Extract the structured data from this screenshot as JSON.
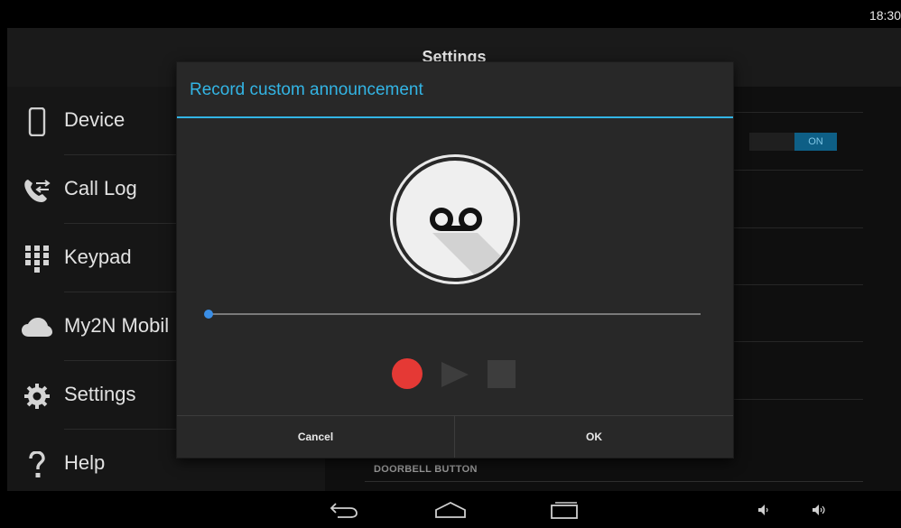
{
  "status_bar": {
    "time": "18:30"
  },
  "action_bar": {
    "title": "Settings"
  },
  "sidebar": {
    "items": [
      {
        "label": "Device",
        "icon": "phone-device-icon"
      },
      {
        "label": "Call Log",
        "icon": "call-log-icon"
      },
      {
        "label": "Keypad",
        "icon": "keypad-icon"
      },
      {
        "label": "My2N Mobil",
        "icon": "cloud-icon"
      },
      {
        "label": "Settings",
        "icon": "gear-icon"
      },
      {
        "label": "Help",
        "icon": "question-icon"
      }
    ]
  },
  "background_content": {
    "toggle_state": "ON",
    "section_label": "DOORBELL BUTTON"
  },
  "dialog": {
    "title": "Record custom announcement",
    "icon": "voicemail-icon",
    "seek_position": 0,
    "controls": [
      "record-icon",
      "play-icon",
      "stop-icon"
    ],
    "cancel_label": "Cancel",
    "ok_label": "OK"
  },
  "nav_bar": {
    "buttons": [
      "back-icon",
      "home-icon",
      "recent-apps-icon",
      "volume-down-icon",
      "volume-up-icon"
    ]
  },
  "colors": {
    "accent": "#33b5e5",
    "record": "#e53935",
    "seek_thumb": "#3a8ee6",
    "toggle_on": "#0e5f86"
  }
}
